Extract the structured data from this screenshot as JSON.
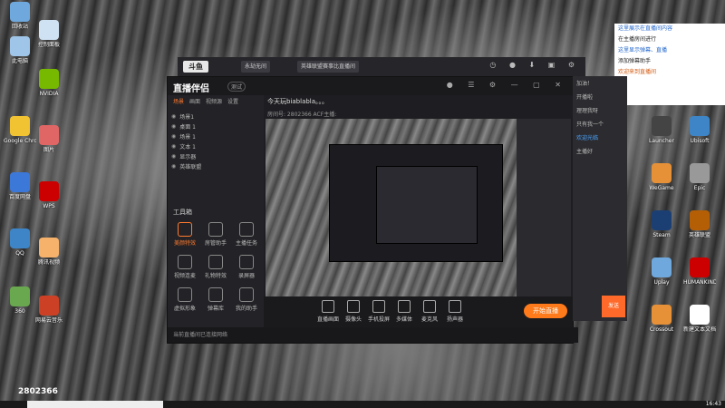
{
  "desktop": {
    "left_icons": [
      {
        "label": "回收站",
        "color": "#6fa8dc"
      },
      {
        "label": "此电脑",
        "color": "#9fc5e8"
      },
      {
        "label": "控制面板",
        "color": "#cfe2f3"
      },
      {
        "label": "NVIDIA",
        "color": "#76b900"
      },
      {
        "label": "Google Chrome",
        "color": "#f1c232"
      },
      {
        "label": "图片",
        "color": "#e06666"
      },
      {
        "label": "百度网盘",
        "color": "#3c78d8"
      },
      {
        "label": "WPS",
        "color": "#cc0000"
      },
      {
        "label": "QQ",
        "color": "#3d85c6"
      },
      {
        "label": "腾讯视频",
        "color": "#f6b26b"
      },
      {
        "label": "360",
        "color": "#6aa84f"
      },
      {
        "label": "网易云音乐",
        "color": "#cc4125"
      }
    ],
    "right_icons": [
      {
        "label": "Launcher",
        "color": "#444444"
      },
      {
        "label": "Ubisoft",
        "color": "#3d85c6"
      },
      {
        "label": "WeGame",
        "color": "#e69138"
      },
      {
        "label": "Epic",
        "color": "#999999"
      },
      {
        "label": "Steam",
        "color": "#1c3f73"
      },
      {
        "label": "英雄联盟",
        "color": "#b45f06"
      },
      {
        "label": "Uplay",
        "color": "#6fa8dc"
      },
      {
        "label": "HUMANKIND",
        "color": "#cc0000"
      },
      {
        "label": "Crossout",
        "color": "#e69138"
      },
      {
        "label": "新建文本文档",
        "color": "#ffffff"
      }
    ],
    "counter_text": "2802366"
  },
  "topstrip": {
    "logo": "斗鱼",
    "tabs": [
      "永劫无间",
      "英雄联盟赛事比直播间"
    ],
    "icons": [
      "clock-icon",
      "record-icon",
      "download-icon",
      "gift-icon",
      "settings-icon"
    ]
  },
  "app": {
    "brand": "直播伴侣",
    "version": "测试",
    "left_tabs": [
      "场景",
      "画面",
      "视频源",
      "设置"
    ],
    "active_left_tab": "场景",
    "scenes": [
      "场景1",
      "桌面 1",
      "场景 1",
      "文本 1",
      "显示器",
      "英雄联盟"
    ],
    "tools_header": "工具箱",
    "tools": [
      {
        "label": "美颜特效"
      },
      {
        "label": "房管助手"
      },
      {
        "label": "主播任务"
      },
      {
        "label": "视频连麦"
      },
      {
        "label": "礼物特效"
      },
      {
        "label": "录屏器"
      },
      {
        "label": "虚拟形象"
      },
      {
        "label": "弹幕库"
      },
      {
        "label": "我的助手"
      }
    ],
    "stream_title": "今天玩biablabla。。。",
    "stream_info": "房间号: 2802366  ACF主播:",
    "bottom_items": [
      "直播画面",
      "摄像头",
      "手机投屏",
      "多媒体",
      "麦克风",
      "扬声器"
    ],
    "go_live_label": "开始直播",
    "status": "当前直播间已连接网络"
  },
  "chat": {
    "messages": [
      {
        "text": "加油！",
        "hl": false
      },
      {
        "text": "开播啦",
        "hl": false
      },
      {
        "text": "理理我呀",
        "hl": false
      },
      {
        "text": "只有我一个",
        "hl": false
      },
      {
        "text": "欢迎光临",
        "hl": true
      },
      {
        "text": "主播好",
        "hl": false
      }
    ],
    "send_label": "发送"
  },
  "notice": {
    "lines": [
      {
        "text": "这里展示在直播间内容",
        "cls": "blue"
      },
      {
        "text": "在主播房间进行",
        "cls": ""
      },
      {
        "text": "这里显示弹幕、直播",
        "cls": "blue"
      },
      {
        "text": "添加弹幕助手",
        "cls": ""
      },
      {
        "text": "欢迎来到直播间",
        "cls": "orange"
      }
    ]
  },
  "taskbar": {
    "clock": "16:43"
  }
}
